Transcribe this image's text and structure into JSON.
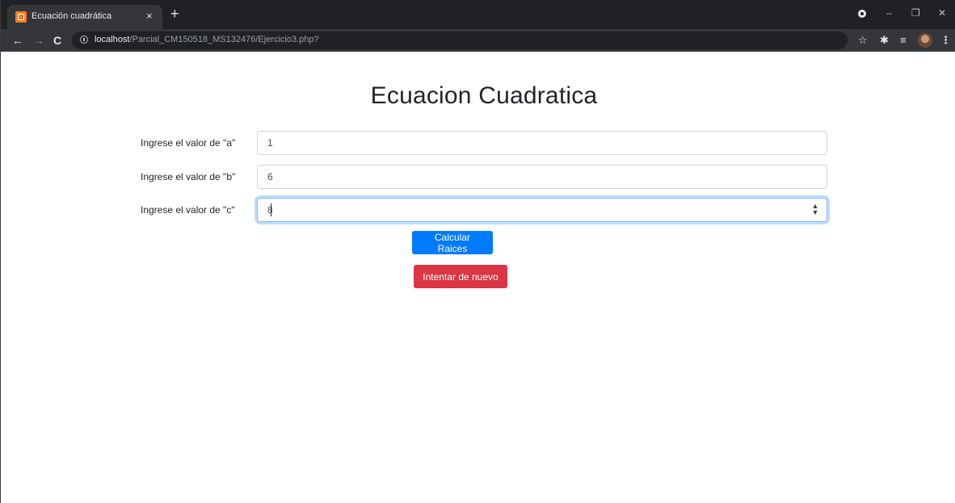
{
  "browser": {
    "tab": {
      "title": "Ecuación cuadrática",
      "close_glyph": "×",
      "favicon": "xampp-icon"
    },
    "new_tab_glyph": "+",
    "url_host": "localhost",
    "url_path": "/Parcial_CM150518_MS132476/Ejercicio3.php?",
    "icons": {
      "back": "←",
      "forward": "→",
      "reload": "C",
      "star": "☆",
      "extensions": "✱",
      "reading_list": "≡",
      "menu": "⋮",
      "minimize": "–",
      "restore": "❐",
      "close": "✕"
    }
  },
  "page": {
    "heading": "Ecuacion Cuadratica",
    "fields": [
      {
        "label": "Ingrese el valor de \"a\"",
        "value": "1"
      },
      {
        "label": "Ingrese el valor de \"b\"",
        "value": "6"
      },
      {
        "label": "Ingrese el valor de \"c\"",
        "value": "8"
      }
    ],
    "buttons": {
      "calculate": "Calcular Raices",
      "retry": "Intentar de nuevo"
    }
  },
  "colors": {
    "primary": "#007bff",
    "danger": "#dc3545",
    "focus_border": "#80bdff"
  }
}
